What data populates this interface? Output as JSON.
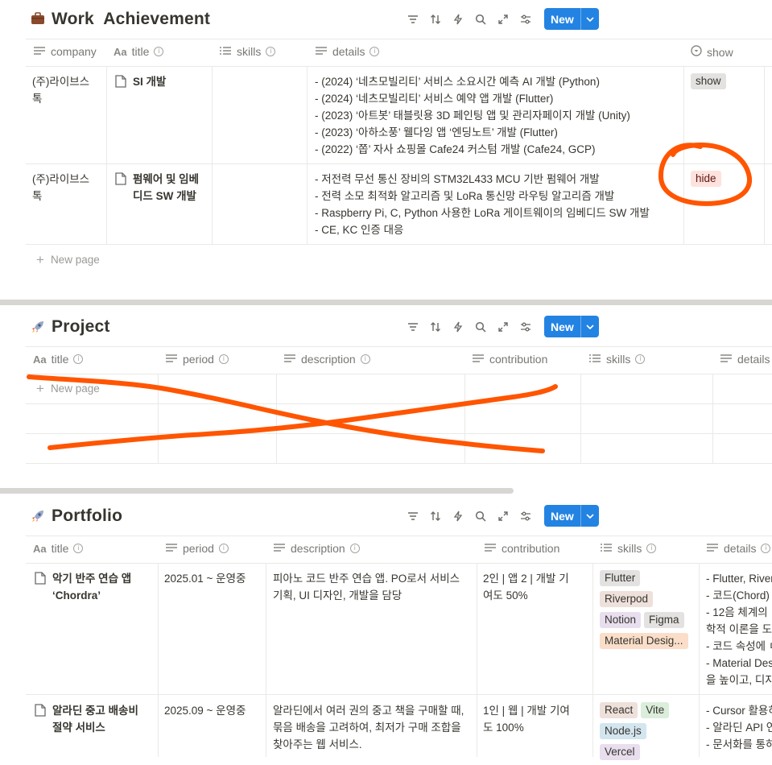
{
  "work": {
    "title": "Work  Achievement",
    "toolbar_new": "New",
    "columns": [
      "company",
      "title",
      "skills",
      "details",
      "show"
    ],
    "rows": [
      {
        "company": "(주)라이브스\n톡",
        "title": "SI 개발",
        "details": [
          "- (2024) ‘네츠모빌리티’ 서비스 소요시간 예측 AI 개발 (Python)",
          "- (2024) ‘네츠모빌리티’ 서비스 예약 앱 개발 (Flutter)",
          "- (2023) ‘아트봇’ 태블릿용 3D 페인팅 앱 및 관리자페이지 개발 (Unity)",
          "- (2023) ‘아하소풍’ 웰다잉 앱 ‘엔딩노트’ 개발 (Flutter)",
          "- (2022) ‘쫍’ 자사 쇼핑몰 Cafe24 커스텀 개발 (Cafe24, GCP)"
        ],
        "show": "show"
      },
      {
        "company": "(주)라이브스\n톡",
        "title": "펌웨어 및 임베\n디드 SW 개발",
        "details": [
          "- 저전력 무선 통신 장비의 STM32L433 MCU 기반 펌웨어 개발",
          "- 전력 소모 최적화 알고리즘 및 LoRa 통신망 라우팅 알고리즘 개발",
          "- Raspberry Pi, C, Python 사용한 LoRa 게이트웨이의 임베디드 SW 개발",
          "- CE, KC 인증 대응"
        ],
        "show": "hide"
      }
    ],
    "new_page": "New page"
  },
  "project": {
    "title": "Project",
    "toolbar_new": "New",
    "columns": [
      "title",
      "period",
      "description",
      "contribution",
      "skills",
      "details"
    ],
    "new_page": "New page"
  },
  "portfolio": {
    "title": "Portfolio",
    "toolbar_new": "New",
    "columns": [
      "title",
      "period",
      "description",
      "contribution",
      "skills",
      "details"
    ],
    "rows": [
      {
        "title": "악기 반주 연습 앱\n‘Chordra’",
        "period": "2025.01 ~ 운영중",
        "description": "피아노 코드 반주 연습 앱. PO로서 서비스\n기획, UI 디자인, 개발을 담당",
        "contribution": "2인 | 앱 2 | 개발 기\n여도 50%",
        "skills": [
          {
            "label": "Flutter",
            "color": "gray"
          },
          {
            "label": "Riverpod",
            "color": "brown"
          },
          {
            "label": "Notion",
            "color": "purple"
          },
          {
            "label": "Figma",
            "color": "gray"
          },
          {
            "label": "Material Desig...",
            "color": "orange"
          }
        ],
        "details": [
          "- Flutter, River",
          "- 코드(Chord)",
          "- 12음 체계의",
          "학적 이론을 도",
          "- 코드 속성에 ㄷ",
          "- Material Des",
          "을 높이고, 디자"
        ]
      },
      {
        "title": "알라딘 중고 배송비\n절약 서비스",
        "period": "2025.09 ~ 운영중",
        "description": "알라딘에서 여러 권의 중고 책을 구매할 때,\n묶음 배송을 고려하여, 최저가 구매 조합을\n찾아주는 웹 서비스.",
        "contribution": "1인 | 웹 | 개발 기여\n도 100%",
        "skills": [
          {
            "label": "React",
            "color": "brown"
          },
          {
            "label": "Vite",
            "color": "green"
          },
          {
            "label": "Node.js",
            "color": "blue"
          },
          {
            "label": "Vercel",
            "color": "purple"
          }
        ],
        "details": [
          "- Cursor 활용하",
          "- 알라딘 API 연",
          "- 문서화를 통하"
        ]
      }
    ]
  },
  "colors": {
    "accent": "#2383e2",
    "annotation": "#ff5500",
    "separator": "#d7d6d2"
  }
}
